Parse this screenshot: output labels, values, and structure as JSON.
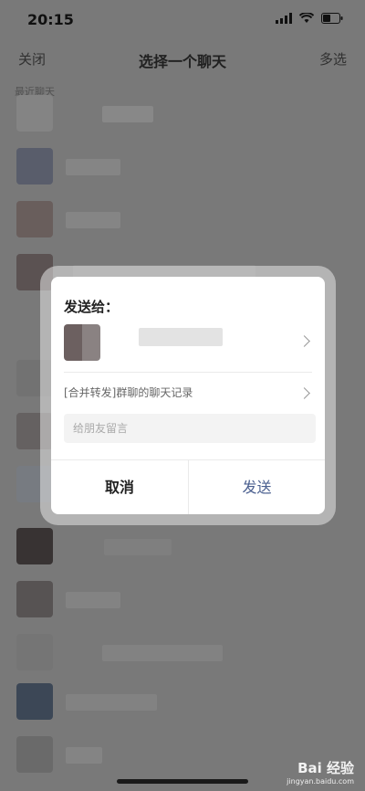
{
  "status": {
    "time": "20:15"
  },
  "nav": {
    "close": "关闭",
    "title": "选择一个聊天",
    "multi": "多选"
  },
  "section_label": "最近聊天",
  "dialog": {
    "title": "发送给：",
    "record": "[合并转发]群聊的聊天记录",
    "input_placeholder": "给朋友留言",
    "cancel": "取消",
    "send": "发送"
  },
  "watermark": {
    "logo": "Bai 经验",
    "url": "jingyan.baidu.com"
  }
}
